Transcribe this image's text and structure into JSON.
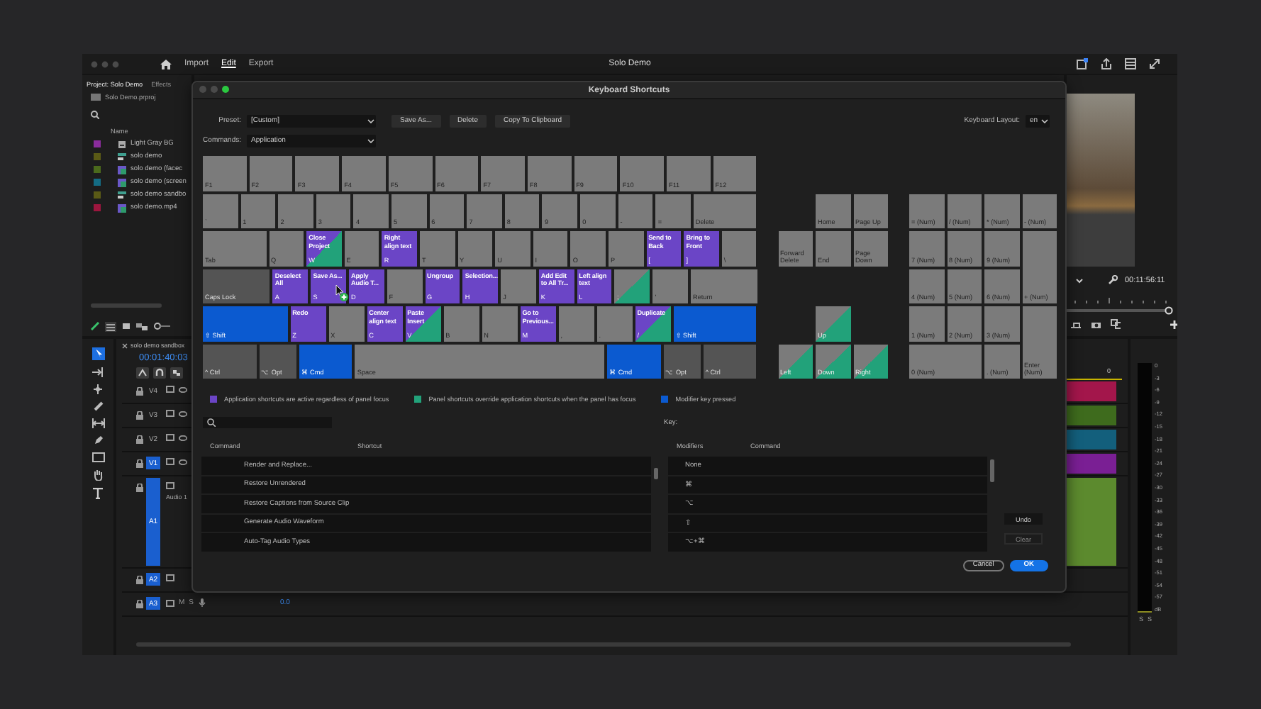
{
  "app": {
    "menu": [
      {
        "label": "Import",
        "selected": false
      },
      {
        "label": "Edit",
        "selected": true
      },
      {
        "label": "Export",
        "selected": false
      }
    ],
    "title": "Solo Demo"
  },
  "project_panel": {
    "tabs": [
      {
        "label": "Project: Solo Demo",
        "selected": true
      },
      {
        "label": "Effects",
        "selected": false
      }
    ],
    "file": "Solo Demo.prproj",
    "column": "Name",
    "items": [
      {
        "name": "Light Gray BG",
        "kind": "graphic",
        "color": "#8a2c9c"
      },
      {
        "name": "solo demo",
        "kind": "sequence",
        "color": "#5a5a16"
      },
      {
        "name": "solo demo (facec",
        "kind": "clip",
        "color": "#4b6a1c"
      },
      {
        "name": "solo demo (screen",
        "kind": "clip",
        "color": "#146c84"
      },
      {
        "name": "solo demo sandbo",
        "kind": "sequence",
        "color": "#5a5a16"
      },
      {
        "name": "solo demo.mp4",
        "kind": "clip",
        "color": "#9c163e"
      }
    ]
  },
  "timeline": {
    "tab": "solo demo sandbox",
    "timecode": "00:01:40:03",
    "ruler_label": "0",
    "tracks": [
      {
        "name": "V4",
        "kind": "video",
        "targeted": false,
        "expanded": false,
        "color": "#a3164b"
      },
      {
        "name": "V3",
        "kind": "video",
        "targeted": false,
        "expanded": false,
        "color": "#3e6b1d"
      },
      {
        "name": "V2",
        "kind": "video",
        "targeted": false,
        "expanded": false,
        "color": "#135f7c"
      },
      {
        "name": "V1",
        "kind": "video",
        "targeted": true,
        "expanded": false,
        "color": "#7a1f94"
      },
      {
        "name": "A1",
        "kind": "audio",
        "targeted": true,
        "expanded": true,
        "label": "Audio 1",
        "color": "#5c8a2e"
      },
      {
        "name": "A2",
        "kind": "audio",
        "targeted": true,
        "expanded": false
      },
      {
        "name": "A3",
        "kind": "audio",
        "targeted": true,
        "expanded": false,
        "mute": "M",
        "solo": "S",
        "volume": "0.0"
      }
    ]
  },
  "program_monitor": {
    "timecode": "00:11:56:11"
  },
  "audio_meter": {
    "scale": [
      "0",
      "-3",
      "-6",
      "-9",
      "-12",
      "-15",
      "-18",
      "-21",
      "-24",
      "-27",
      "-30",
      "-33",
      "-36",
      "-39",
      "-42",
      "-45",
      "-48",
      "-51",
      "-54",
      "-57",
      "dB"
    ],
    "solo": [
      "S",
      "S"
    ]
  },
  "dialog": {
    "title": "Keyboard Shortcuts",
    "preset_label": "Preset:",
    "preset": "[Custom]",
    "buttons": [
      "Save As...",
      "Delete",
      "Copy To Clipboard"
    ],
    "layout_label": "Keyboard Layout:",
    "layout": "en",
    "commands_label": "Commands:",
    "commands": "Application",
    "keyboard": {
      "main_rows": [
        [
          {
            "label": "F1",
            "kind": "plain"
          },
          {
            "label": "F2",
            "kind": "plain"
          },
          {
            "label": "F3",
            "kind": "plain"
          },
          {
            "label": "F4",
            "kind": "plain"
          },
          {
            "label": "F5",
            "kind": "plain"
          },
          {
            "label": "F6",
            "kind": "plain"
          },
          {
            "label": "F7",
            "kind": "plain"
          },
          {
            "label": "F8",
            "kind": "plain"
          },
          {
            "label": "F9",
            "kind": "plain"
          },
          {
            "label": "F10",
            "kind": "plain"
          },
          {
            "label": "F11",
            "kind": "plain"
          },
          {
            "label": "F12",
            "kind": "plain"
          }
        ],
        [
          {
            "label": "`",
            "kind": "plain"
          },
          {
            "label": "1",
            "kind": "plain"
          },
          {
            "label": "2",
            "kind": "plain"
          },
          {
            "label": "3",
            "kind": "plain"
          },
          {
            "label": "4",
            "kind": "plain"
          },
          {
            "label": "5",
            "kind": "plain"
          },
          {
            "label": "6",
            "kind": "plain"
          },
          {
            "label": "7",
            "kind": "plain"
          },
          {
            "label": "8",
            "kind": "plain"
          },
          {
            "label": "9",
            "kind": "plain"
          },
          {
            "label": "0",
            "kind": "plain"
          },
          {
            "label": "-",
            "kind": "plain"
          },
          {
            "label": "=",
            "kind": "plain"
          },
          {
            "label": "Delete",
            "kind": "plain"
          }
        ],
        [
          {
            "label": "Tab",
            "kind": "plain"
          },
          {
            "label": "Q",
            "kind": "plain"
          },
          {
            "label": "W",
            "command": "Close Project",
            "kind": "both"
          },
          {
            "label": "E",
            "kind": "plain"
          },
          {
            "label": "R",
            "command": "Right align text",
            "kind": "app"
          },
          {
            "label": "T",
            "kind": "plain"
          },
          {
            "label": "Y",
            "kind": "plain"
          },
          {
            "label": "U",
            "kind": "plain"
          },
          {
            "label": "I",
            "kind": "plain"
          },
          {
            "label": "O",
            "kind": "plain"
          },
          {
            "label": "P",
            "kind": "plain"
          },
          {
            "label": "[",
            "command": "Send to Back",
            "kind": "app"
          },
          {
            "label": "]",
            "command": "Bring to Front",
            "kind": "app"
          },
          {
            "label": "\\",
            "kind": "plain"
          }
        ],
        [
          {
            "label": "Caps Lock",
            "kind": "locked"
          },
          {
            "label": "A",
            "command": "Deselect All",
            "kind": "app"
          },
          {
            "label": "S",
            "command": "Save As...",
            "kind": "app"
          },
          {
            "label": "D",
            "command": "Apply Audio T...",
            "kind": "app"
          },
          {
            "label": "F",
            "kind": "plain"
          },
          {
            "label": "G",
            "command": "Ungroup",
            "kind": "app"
          },
          {
            "label": "H",
            "command": "Selection...",
            "kind": "app"
          },
          {
            "label": "J",
            "kind": "plain"
          },
          {
            "label": "K",
            "command": "Add Edit to All Tr...",
            "kind": "app"
          },
          {
            "label": "L",
            "command": "Left align text",
            "kind": "app"
          },
          {
            "label": ";",
            "kind": "panel"
          },
          {
            "label": "'",
            "kind": "plain"
          },
          {
            "label": "Return",
            "kind": "plain"
          }
        ],
        [
          {
            "label": "⇧ Shift",
            "kind": "modifier"
          },
          {
            "label": "Z",
            "command": "Redo",
            "kind": "app"
          },
          {
            "label": "X",
            "kind": "plain"
          },
          {
            "label": "C",
            "command": "Center align text",
            "kind": "app"
          },
          {
            "label": "V",
            "command": "Paste Insert",
            "kind": "both"
          },
          {
            "label": "B",
            "kind": "plain"
          },
          {
            "label": "N",
            "kind": "plain"
          },
          {
            "label": "M",
            "command": "Go to Previous...",
            "kind": "app"
          },
          {
            "label": ",",
            "kind": "plain"
          },
          {
            "label": ".",
            "kind": "plain"
          },
          {
            "label": "/",
            "command": "Duplicate",
            "kind": "both"
          },
          {
            "label": "⇧ Shift",
            "kind": "modifier"
          }
        ],
        [
          {
            "label": "^ Ctrl",
            "kind": "locked"
          },
          {
            "label": "⌥ Opt",
            "kind": "locked"
          },
          {
            "label": "⌘ Cmd",
            "kind": "modifier"
          },
          {
            "label": "Space",
            "kind": "plain"
          },
          {
            "label": "⌘ Cmd",
            "kind": "modifier"
          },
          {
            "label": "⌥ Opt",
            "kind": "locked"
          },
          {
            "label": "^ Ctrl",
            "kind": "locked"
          }
        ]
      ],
      "nav_keys": [
        {
          "label": "Home",
          "kind": "plain"
        },
        {
          "label": "Page Up",
          "kind": "plain"
        },
        {
          "label": "Forward Delete",
          "kind": "plain"
        },
        {
          "label": "End",
          "kind": "plain"
        },
        {
          "label": "Page Down",
          "kind": "plain"
        },
        {
          "label": "Up",
          "kind": "panel"
        },
        {
          "label": "Left",
          "kind": "panel"
        },
        {
          "label": "Down",
          "kind": "panel"
        },
        {
          "label": "Right",
          "kind": "panel"
        }
      ],
      "numpad_keys": [
        {
          "label": "= (Num)",
          "kind": "plain"
        },
        {
          "label": "/ (Num)",
          "kind": "plain"
        },
        {
          "label": "* (Num)",
          "kind": "plain"
        },
        {
          "label": "- (Num)",
          "kind": "plain"
        },
        {
          "label": "7 (Num)",
          "kind": "plain"
        },
        {
          "label": "8 (Num)",
          "kind": "plain"
        },
        {
          "label": "9 (Num)",
          "kind": "plain"
        },
        {
          "label": "4 (Num)",
          "kind": "plain"
        },
        {
          "label": "5 (Num)",
          "kind": "plain"
        },
        {
          "label": "6 (Num)",
          "kind": "plain"
        },
        {
          "label": "+ (Num)",
          "kind": "plain"
        },
        {
          "label": "1 (Num)",
          "kind": "plain"
        },
        {
          "label": "2 (Num)",
          "kind": "plain"
        },
        {
          "label": "3 (Num)",
          "kind": "plain"
        },
        {
          "label": "0 (Num)",
          "kind": "plain"
        },
        {
          "label": ". (Num)",
          "kind": "plain"
        },
        {
          "label": "Enter (Num)",
          "kind": "plain"
        }
      ]
    },
    "legend": [
      {
        "color": "#6b45c6",
        "text": "Application shortcuts are active regardless of panel focus"
      },
      {
        "color": "#22a27a",
        "text": "Panel shortcuts override application shortcuts when the panel has focus"
      },
      {
        "color": "#0b5ad0",
        "text": "Modifier key pressed"
      }
    ],
    "key_label": "Key:",
    "command_table": {
      "columns": [
        "Command",
        "Shortcut"
      ],
      "rows": [
        "Render and Replace...",
        "Restore Unrendered",
        "Restore Captions from Source Clip",
        "Generate Audio Waveform",
        "Auto-Tag Audio Types"
      ]
    },
    "modifier_table": {
      "columns": [
        "Modifiers",
        "Command"
      ],
      "rows": [
        "None",
        "⌘",
        "⌥",
        "⇧",
        "⌥+⌘"
      ]
    },
    "side_buttons": [
      {
        "label": "Undo",
        "disabled": false
      },
      {
        "label": "Clear",
        "disabled": true
      }
    ],
    "footer_buttons": [
      {
        "label": "Cancel",
        "kind": "secondary"
      },
      {
        "label": "OK",
        "kind": "primary"
      }
    ]
  }
}
